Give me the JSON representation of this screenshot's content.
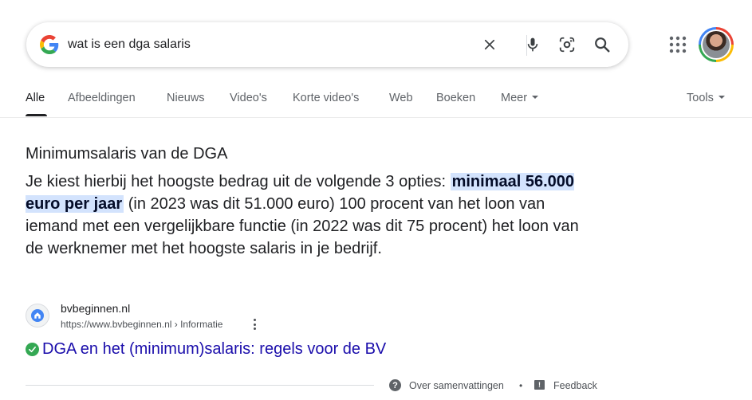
{
  "search": {
    "query": "wat is een dga salaris"
  },
  "icons": {
    "logo": "google-g-icon",
    "clear": "close-icon",
    "voice": "microphone-icon",
    "lens": "camera-lens-icon",
    "search": "search-icon",
    "apps": "apps-grid-icon",
    "avatar": "account-avatar"
  },
  "tabs": [
    {
      "label": "Alle",
      "active": true
    },
    {
      "label": "Afbeeldingen"
    },
    {
      "label": "Nieuws"
    },
    {
      "label": "Video's"
    },
    {
      "label": "Korte video's"
    },
    {
      "label": "Web"
    },
    {
      "label": "Boeken"
    },
    {
      "label": "Meer"
    }
  ],
  "tools_label": "Tools",
  "snippet": {
    "title": "Minimumsalaris van de DGA",
    "text_before": "Je kiest hierbij het hoogste bedrag uit de volgende 3 opties: ",
    "highlight": "minimaal 56.000 euro per jaar",
    "text_after": " (in 2023 was dit 51.000 euro) 100 procent van het loon van iemand met een vergelijkbare functie (in 2022 was dit 75 procent) het loon van de werknemer met het hoogste salaris in je bedrijf."
  },
  "source": {
    "site_name": "bvbeginnen.nl",
    "url": "https://www.bvbeginnen.nl › Informatie",
    "link_title": "DGA en het (minimum)salaris: regels voor de BV"
  },
  "footer": {
    "about": "Over samenvattingen",
    "separator": "•",
    "feedback": "Feedback"
  },
  "colors": {
    "link": "#1a0dab",
    "highlight_bg": "#d3e3fd",
    "verified": "#34a853"
  }
}
